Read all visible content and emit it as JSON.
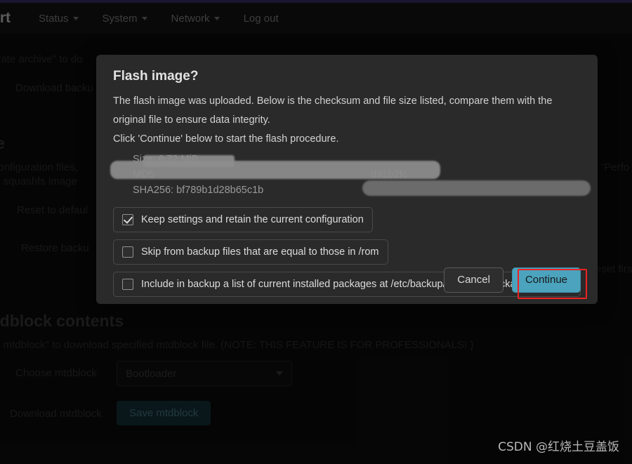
{
  "navbar": {
    "brand": "/rt",
    "items": [
      {
        "label": "Status",
        "has_caret": true
      },
      {
        "label": "System",
        "has_caret": true
      },
      {
        "label": "Network",
        "has_caret": true
      },
      {
        "label": "Log out",
        "has_caret": false
      }
    ]
  },
  "background": {
    "line_archive": "erate archive\" to do",
    "btn_download_backup": "Download backu",
    "heading_partial": "e",
    "line_config_files": "configuration files,",
    "line_squashfs": "th squashfs image",
    "btn_reset_default": "Reset to defaul",
    "btn_restore_backup": "Restore backu",
    "right_perform": "\"Perfo",
    "right_reset_first": "eset firs",
    "mtdblock_heading": "tdblock contents",
    "mtdblock_note": "e mtdblock\" to download specified mtdblock file. (NOTE: THIS FEATURE IS FOR PROFESSIONALS! )",
    "choose_mtdblock_label": "Choose mtdblock",
    "choose_mtdblock_value": "Bootloader",
    "download_mtdblock_label": "Download mtdblock",
    "save_mtdblock_button": "Save mtdblock"
  },
  "dialog": {
    "title": "Flash image?",
    "body_line1": "The flash image was uploaded. Below is the checksum and file size listed, compare them with the",
    "body_line2": "original file to ensure data integrity.",
    "body_line3": "Click 'Continue' below to start the flash procedure.",
    "checksums": {
      "size": "Size: 6.72 MiB",
      "md5": "MD5",
      "md5_tail": "d91b2fc",
      "sha256": "SHA256: bf789b1d28b65c1b"
    },
    "checkboxes": [
      {
        "label": "Keep settings and retain the current configuration",
        "checked": true
      },
      {
        "label": "Skip from backup files that are equal to those in /rom",
        "checked": false
      },
      {
        "label": "Include in backup a list of current installed packages at /etc/backup/installed_packages.txt",
        "checked": false
      }
    ],
    "cancel_label": "Cancel",
    "continue_label": "Continue"
  },
  "annotation": {
    "color": "#ee2222"
  },
  "watermark": {
    "text": "CSDN @红烧土豆盖饭"
  },
  "colors": {
    "accent_top": "#3b3470",
    "continue_button": "#4ba3bd",
    "dialog_bg": "#2a2a2a",
    "page_bg": "#0d0d0d"
  }
}
